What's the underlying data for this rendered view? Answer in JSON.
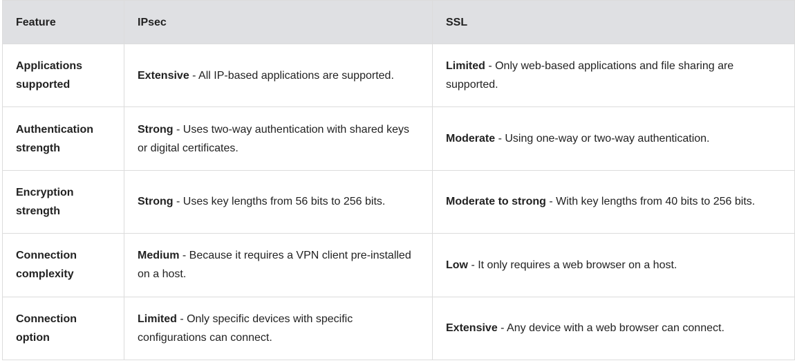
{
  "header": {
    "feature": "Feature",
    "ipsec": "IPsec",
    "ssl": "SSL"
  },
  "rows": [
    {
      "feature": "Applications supported",
      "ipsec_lead": "Extensive",
      "ipsec_text": " - All IP-based applications are supported.",
      "ssl_lead": "Limited",
      "ssl_text": " - Only web-based applications and file sharing are supported."
    },
    {
      "feature": "Authentication strength",
      "ipsec_lead": "Strong",
      "ipsec_text": " - Uses two-way authentication with shared keys or digital certificates.",
      "ssl_lead": "Moderate",
      "ssl_text": " - Using one-way or two-way authentication."
    },
    {
      "feature": "Encryption strength",
      "ipsec_lead": "Strong",
      "ipsec_text": " - Uses key lengths from 56 bits to 256 bits.",
      "ssl_lead": "Moderate to strong",
      "ssl_text": " - With key lengths from 40 bits to 256 bits."
    },
    {
      "feature": "Connection complexity",
      "ipsec_lead": "Medium",
      "ipsec_text": " - Because it requires a VPN client pre-installed on a host.",
      "ssl_lead": "Low",
      "ssl_text": " - It only requires a web browser on a host."
    },
    {
      "feature": "Connection option",
      "ipsec_lead": "Limited",
      "ipsec_text": " - Only specific devices with specific configurations can connect.",
      "ssl_lead": "Extensive",
      "ssl_text": " - Any device with a web browser can connect."
    }
  ]
}
